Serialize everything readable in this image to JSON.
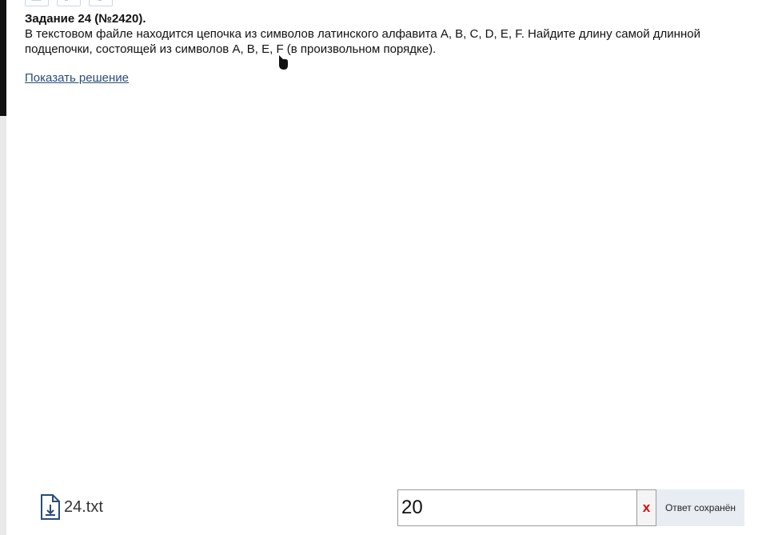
{
  "task": {
    "title": "Задание 24 (№2420).",
    "line1": "В текстовом файле находится цепочка из символов латинского алфавита A, B, C, D, E, F. Найдите длину самой длинной",
    "line2": "подцепочки, состоящей из символов A, B, E, F (в произвольном порядке).",
    "show_solution_label": "Показать решение"
  },
  "file": {
    "name": "24.txt",
    "icon": "download-file-icon"
  },
  "answer": {
    "value": "20",
    "clear_label": "x",
    "status": "Ответ сохранён"
  },
  "colors": {
    "link": "#2a4c78",
    "clear": "#e00000",
    "status_bg": "#e8edf3"
  }
}
